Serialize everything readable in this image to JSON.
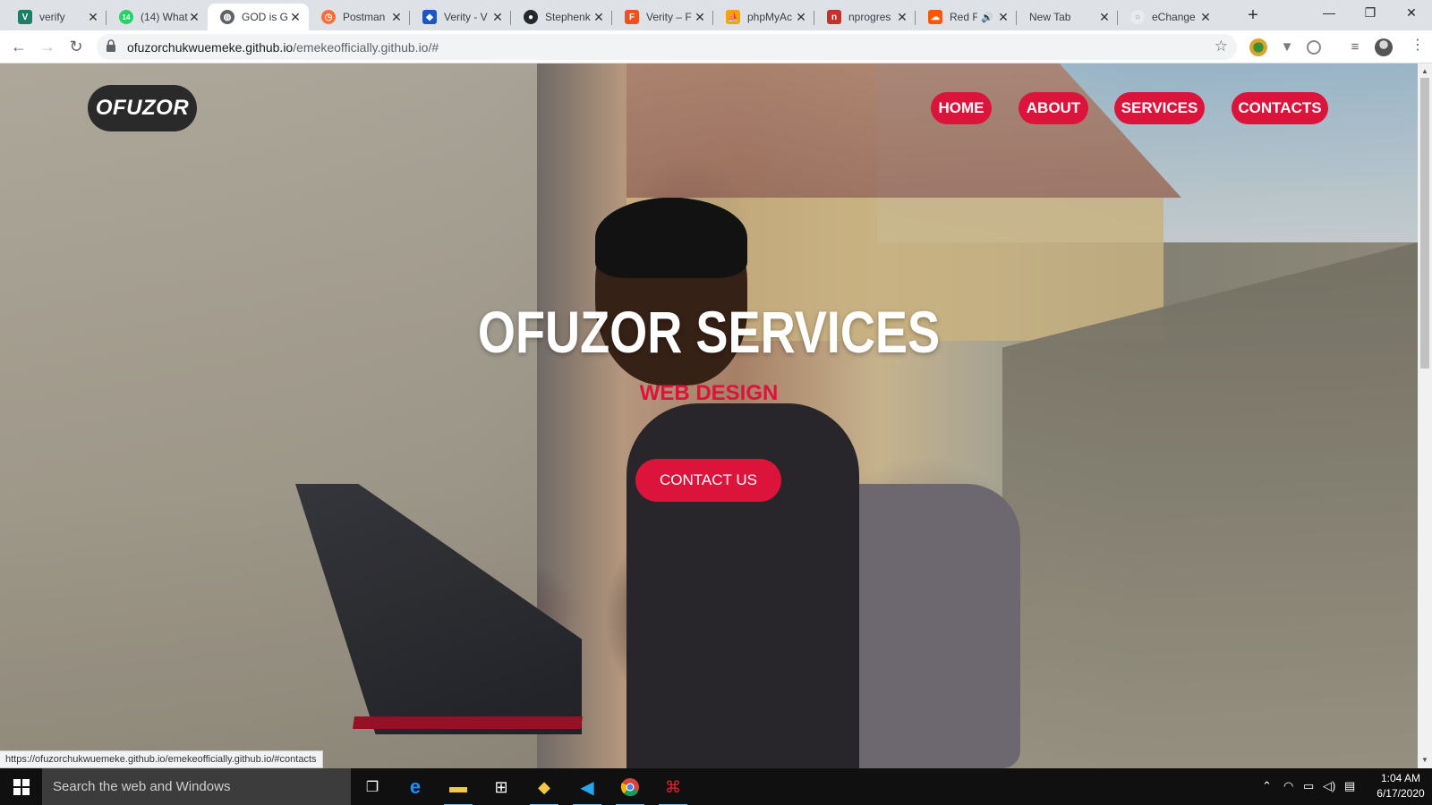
{
  "browser": {
    "tabs": [
      {
        "title": "verify",
        "fav_color": "#1a7f64",
        "fav_glyph": "V"
      },
      {
        "title": "(14) What",
        "fav_color": "#25d366",
        "fav_glyph": "14"
      },
      {
        "title": "GOD is G",
        "fav_color": "#5f6368",
        "fav_glyph": "🌐",
        "active": true
      },
      {
        "title": "Postman",
        "fav_color": "#ff6c37",
        "fav_glyph": "◷"
      },
      {
        "title": "Verity - V",
        "fav_color": "#1a56c4",
        "fav_glyph": "◆"
      },
      {
        "title": "Stephenk",
        "fav_color": "#24292e",
        "fav_glyph": "●"
      },
      {
        "title": "Verity – F",
        "fav_color": "#f24e1e",
        "fav_glyph": "F"
      },
      {
        "title": "phpMyAc",
        "fav_color": "#f6a300",
        "fav_glyph": "⛵"
      },
      {
        "title": "nprogres",
        "fav_color": "#c4302b",
        "fav_glyph": "n"
      },
      {
        "title": "Red F",
        "fav_color": "#ff5500",
        "fav_glyph": "☁"
      },
      {
        "title": "New Tab",
        "fav_color": "transparent",
        "fav_glyph": ""
      },
      {
        "title": "eChange",
        "fav_color": "#e8eaed",
        "fav_glyph": "○"
      }
    ],
    "url_host": "ofuzorchukwuemeke.github.io",
    "url_path": "/emekeofficially.github.io/#",
    "status_link": "https://ofuzorchukwuemeke.github.io/emekeofficially.github.io/#contacts"
  },
  "site": {
    "logo": "OFUZOR",
    "nav": [
      "HOME",
      "ABOUT",
      "SERVICES",
      "CONTACTS"
    ],
    "hero_title": "OFUZOR SERVICES",
    "hero_subtitle": "WEB DESIGN",
    "cta": "CONTACT US",
    "accent": "#dc143c"
  },
  "taskbar": {
    "search_placeholder": "Search the web and Windows",
    "time": "1:04 AM",
    "date": "6/17/2020"
  }
}
